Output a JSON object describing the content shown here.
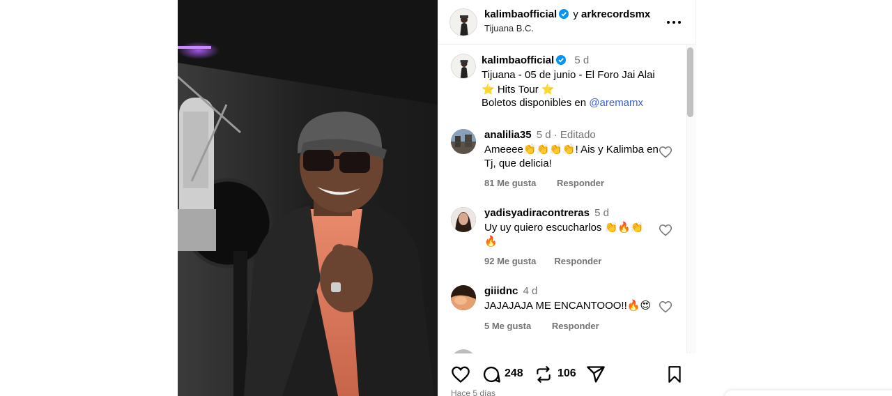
{
  "post": {
    "author": "kalimbaofficial",
    "joiner": "y",
    "collaborator": "arkrecordsmx",
    "location": "Tijuana B.C."
  },
  "caption": {
    "username": "kalimbaofficial",
    "time": "5 d",
    "line1": "Tijuana - 05 de junio - El Foro Jai Alai",
    "line2": "⭐ Hits Tour ⭐",
    "line3_prefix": "Boletos disponibles en",
    "mention": "@aremamx"
  },
  "comments": [
    {
      "username": "analilia35",
      "time": "5 d · Editado",
      "text": "Ameeee👏👏👏👏! Ais y Kalimba en Tj, que delicia!",
      "likes": "81 Me gusta",
      "reply": "Responder"
    },
    {
      "username": "yadisyadiracontreras",
      "time": "5 d",
      "text": "Uy uy quiero escucharlos 👏🔥👏 🔥",
      "likes": "92 Me gusta",
      "reply": "Responder"
    },
    {
      "username": "giiidnc",
      "time": "4 d",
      "text": "JAJAJAJA ME ENCANTOOO!!🔥😍",
      "likes": "5 Me gusta",
      "reply": "Responder"
    }
  ],
  "actions": {
    "comment_count": "248",
    "repost_count": "106",
    "posted_ago": "Hace 5 días"
  },
  "icons": [
    "verified-badge-icon",
    "more-options-icon",
    "heart-icon",
    "comment-icon",
    "repost-icon",
    "share-icon",
    "bookmark-icon"
  ],
  "colors": {
    "verified": "#0095f6",
    "mention": "#3a5fcd",
    "muted": "#737373"
  }
}
